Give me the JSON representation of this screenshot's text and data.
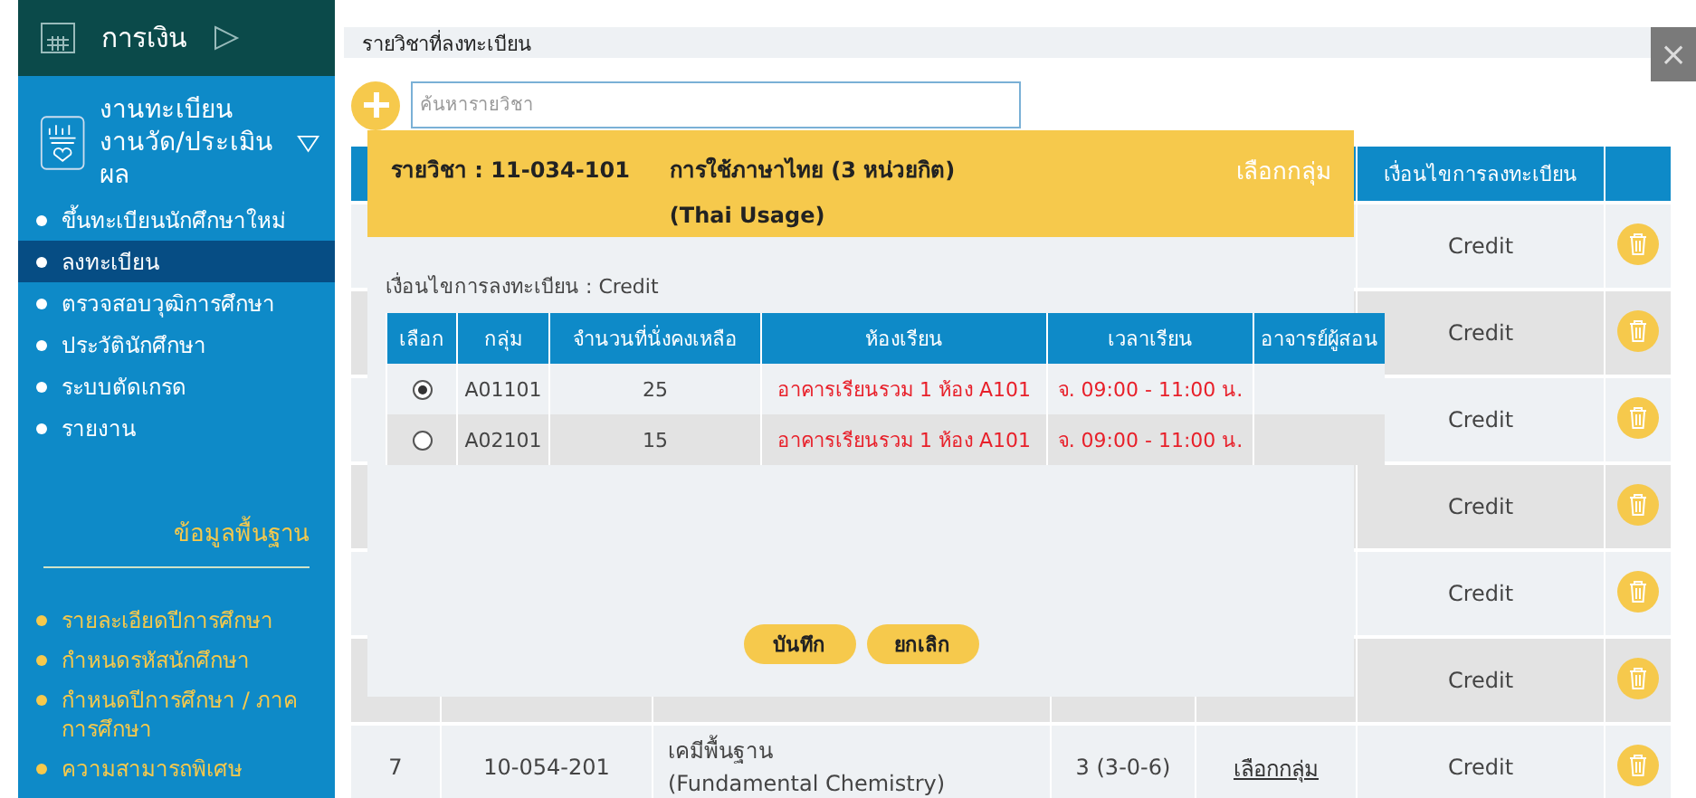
{
  "sidebar": {
    "top_item": {
      "label": "การเงิน"
    },
    "section": {
      "title_lines": [
        "งานทะเบียน",
        "งานวัด/ประเมินผล"
      ]
    },
    "items": [
      {
        "label": "ขึ้นทะเบียนนักศึกษาใหม่",
        "selected": false
      },
      {
        "label": "ลงทะเบียน",
        "selected": true
      },
      {
        "label": "ตรวจสอบวุฒิการศึกษา",
        "selected": false
      },
      {
        "label": "ประวัตินักศึกษา",
        "selected": false
      },
      {
        "label": "ระบบตัดเกรด",
        "selected": false
      },
      {
        "label": "รายงาน",
        "selected": false
      }
    ],
    "basic_data": {
      "title": "ข้อมูลพื้นฐาน",
      "items": [
        "รายละเอียดปีการศึกษา",
        "กำหนดรหัสนักศึกษา",
        "กำหนดปีการศึกษา / ภาคการศึกษา",
        "ความสามารถพิเศษ"
      ]
    }
  },
  "page_title": "รายวิชาที่ลงทะเบียน",
  "close_button": "×",
  "search": {
    "placeholder": "ค้นหารายวิชา"
  },
  "table": {
    "columns": [
      {
        "label": "เงื่อนไขการลงทะเบียน"
      }
    ],
    "rows": [
      {
        "condition": "Credit"
      },
      {
        "condition": "Credit"
      },
      {
        "condition": "Credit"
      },
      {
        "condition": "Credit"
      },
      {
        "condition": "Credit"
      },
      {
        "condition": "Credit"
      },
      {
        "number": "7",
        "code": "10-054-201",
        "name": "เคมีพื้นฐาน",
        "name_en": "(Fundamental Chemistry)",
        "credits": "3 (3-0-6)",
        "action": "เลือกกลุ่ม",
        "condition": "Credit"
      }
    ]
  },
  "modal": {
    "course_label": "รายวิชา : 11-034-101",
    "course_name": "การใช้ภาษาไทย (3 หน่วยกิต)",
    "course_name_en": "(Thai Usage)",
    "heading_action": "เลือกกลุ่ม",
    "condition": "เงื่อนไขการลงทะเบียน : Credit",
    "columns": [
      "เลือก",
      "กลุ่ม",
      "จำนวนที่นั่งคงเหลือ",
      "ห้องเรียน",
      "เวลาเรียน",
      "อาจารย์ผู้สอน"
    ],
    "groups": [
      {
        "selected": true,
        "group": "A01101",
        "seats": "25",
        "room": "อาคารเรียนรวม 1 ห้อง A101",
        "time": "จ. 09:00 - 11:00 น."
      },
      {
        "selected": false,
        "group": "A02101",
        "seats": "15",
        "room": "อาคารเรียนรวม 1 ห้อง A101",
        "time": "จ. 09:00 - 11:00 น."
      }
    ],
    "buttons": [
      "บันทึก",
      "ยกเลิก"
    ]
  }
}
